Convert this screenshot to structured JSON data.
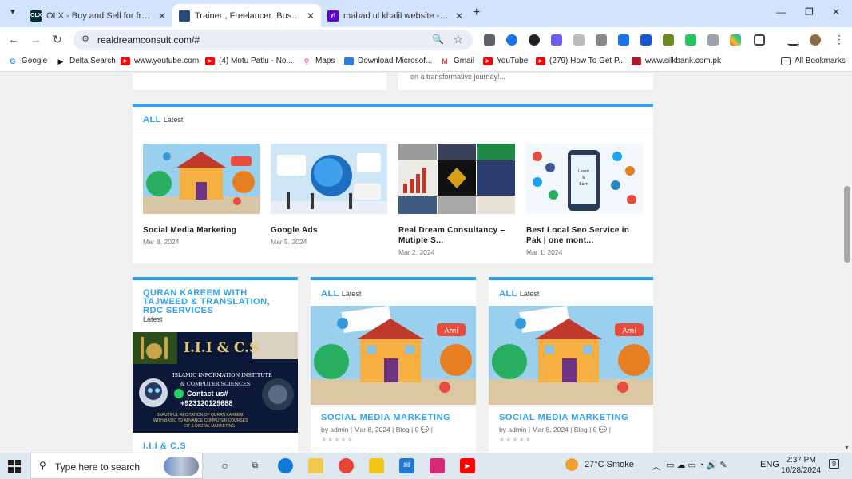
{
  "tabs": [
    {
      "title": "OLX - Buy and Sell for free anyw",
      "favicon": "olx-icon",
      "favicon_text": "OLX",
      "active": false
    },
    {
      "title": "Trainer , Freelancer ,Business Pr",
      "favicon": "site-icon",
      "favicon_text": "",
      "active": true
    },
    {
      "title": "mahad ul khalil website - Yahoo",
      "favicon": "yahoo-icon",
      "favicon_text": "y!",
      "active": false
    }
  ],
  "address_bar": {
    "url": "realdreamconsult.com/#"
  },
  "bookmarks": [
    {
      "label": "Google",
      "icon": "google-icon"
    },
    {
      "label": "Delta Search",
      "icon": "play-icon"
    },
    {
      "label": "www.youtube.com",
      "icon": "youtube-icon"
    },
    {
      "label": "(4) Motu Patlu - No...",
      "icon": "youtube-icon"
    },
    {
      "label": "Maps",
      "icon": "maps-icon"
    },
    {
      "label": "Download Microsof...",
      "icon": "microsoft-icon"
    },
    {
      "label": "Gmail",
      "icon": "gmail-icon"
    },
    {
      "label": "YouTube",
      "icon": "youtube-icon"
    },
    {
      "label": "(279) How To Get P...",
      "icon": "youtube-icon"
    },
    {
      "label": "www.silkbank.com.pk",
      "icon": "silkbank-icon"
    }
  ],
  "all_bookmarks_label": "All Bookmarks",
  "page": {
    "top_snippet": "on a transformative journey!...",
    "latest_section": {
      "heading": "ALL",
      "sub": "Latest",
      "posts": [
        {
          "title": "Social Media Marketing",
          "date": "Mar 8, 2024"
        },
        {
          "title": "Google Ads",
          "date": "Mar 5, 2024"
        },
        {
          "title": "Real Dream Consultancy – Mutiple S...",
          "date": "Mar 2, 2024"
        },
        {
          "title": "Best Local Seo Service in Pak | one mont...",
          "date": "Mar 1, 2024"
        }
      ]
    },
    "quran_section": {
      "heading": "QURAN KAREEM WITH TAJWEED & TRANSLATION, RDC SERVICES",
      "sub": "Latest",
      "image_text": {
        "logo": "I.I.I & C.S",
        "line1": "ISLAMIC INFORMATION INSTITUTE",
        "line2": "& COMPUTER SCIENCES",
        "contact_label": "Contact us#",
        "phone": "+923120129688",
        "footer1": "BEAUTIFUL RECITATION OF QURAN KAREEM",
        "footer2": "WITH BASIC TO ADVANCE COMPUTER COURSES",
        "footer3": "CIT & DIGITAL MARKETING"
      },
      "post_title": "I.I.I & C.S"
    },
    "featured_posts": [
      {
        "heading": "ALL",
        "sub": "Latest",
        "title": "SOCIAL MEDIA MARKETING",
        "author": "admin",
        "date": "Mar 8, 2024",
        "category": "Blog",
        "comments": "0",
        "meta": "by admin | Mar 8, 2024 | Blog | 0 💬 |"
      },
      {
        "heading": "ALL",
        "sub": "Latest",
        "title": "SOCIAL MEDIA MARKETING",
        "author": "admin",
        "date": "Mar 8, 2024",
        "category": "Blog",
        "comments": "0",
        "meta": "by admin | Mar 8, 2024 | Blog | 0 💬 |"
      }
    ]
  },
  "taskbar": {
    "search_placeholder": "Type here to search",
    "weather": "27°C  Smoke",
    "language": "ENG",
    "time": "2:37 PM",
    "date": "10/28/2024",
    "notification_count": "9"
  },
  "colors": {
    "accent": "#2ea3f2",
    "tabbar": "#d3e3fd",
    "taskbar": "#dfe7f1"
  }
}
